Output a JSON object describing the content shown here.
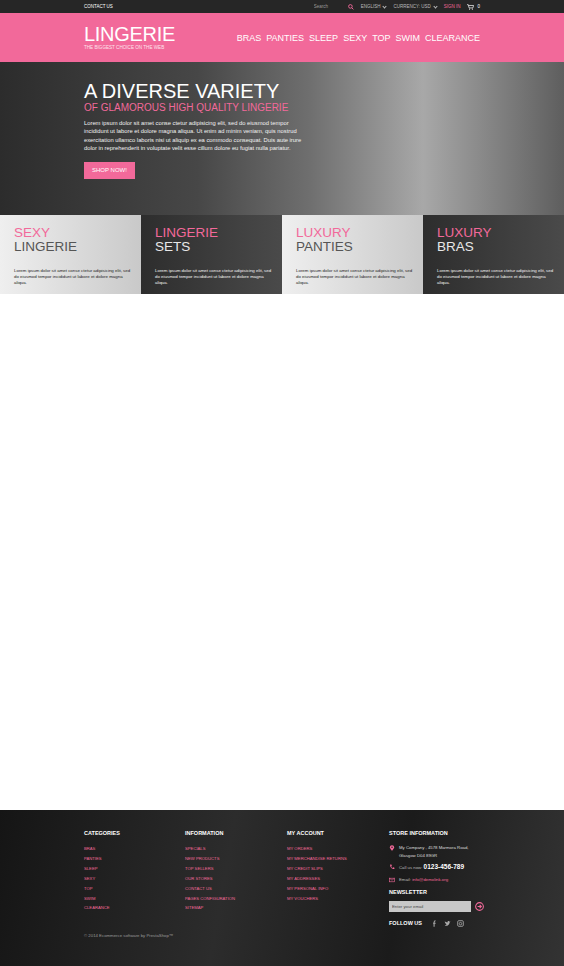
{
  "topbar": {
    "contact": "CONTACT US",
    "search_placeholder": "Search",
    "language": "ENGLISH",
    "currency": "CURRENCY: USD",
    "sign_in": "SIGN IN",
    "cart_count": "0"
  },
  "header": {
    "logo": "LINGERIE",
    "tagline": "THE BIGGEST CHOICE ON THE WEB",
    "nav": [
      "BRAS",
      "PANTIES",
      "SLEEP",
      "SEXY",
      "TOP",
      "SWIM",
      "CLEARANCE"
    ]
  },
  "hero": {
    "title": "A DIVERSE VARIETY",
    "subtitle": "OF GLAMOROUS HIGH QUALITY LINGERIE",
    "text": "Lorem ipsum dolor sit amet conse ctetur adipisicing elit, sed do eiusmod tempor incididunt ut labore et dolore magna aliqua. Ut enim ad minim veniam, quis nostrud exercitation ullamco laboris nisi ut aliquip ex ea commodo consequat. Duis aute irure dolor in reprehenderit in voluptate velit esse cillum dolore eu fugiat nulla pariatur.",
    "button": "SHOP NOW!"
  },
  "banners": [
    {
      "accent": "SEXY",
      "title": "LINGERIE",
      "text": "Lorem ipsum dolor sit amet conse ctetur adipisicing elit, sed do eiusmod tempor incididunt ut labore et dolore magna aliqua."
    },
    {
      "accent": "LINGERIE",
      "title": "SETS",
      "text": "Lorem ipsum dolor sit amet conse ctetur adipisicing elit, sed do eiusmod tempor incididunt ut labore et dolore magna aliqua."
    },
    {
      "accent": "LUXURY",
      "title": "PANTIES",
      "text": "Lorem ipsum dolor sit amet conse ctetur adipisicing elit, sed do eiusmod tempor incididunt ut labore et dolore magna aliqua."
    },
    {
      "accent": "LUXURY",
      "title": "BRAS",
      "text": "Lorem ipsum dolor sit amet conse ctetur adipisicing elit, sed do eiusmod tempor incididunt ut labore et dolore magna aliqua."
    }
  ],
  "footer": {
    "columns": [
      {
        "title": "CATEGORIES",
        "links": [
          "BRAS",
          "PANTIES",
          "SLEEP",
          "SEXY",
          "TOP",
          "SWIM",
          "CLEARANCE"
        ]
      },
      {
        "title": "INFORMATION",
        "links": [
          "SPECIALS",
          "NEW PRODUCTS",
          "TOP SELLERS",
          "OUR STORES",
          "CONTACT US",
          "PAGES CONFIGURATION",
          "SITEMAP"
        ]
      },
      {
        "title": "MY ACCOUNT",
        "links": [
          "MY ORDERS",
          "MY MERCHANDISE RETURNS",
          "MY CREDIT SLIPS",
          "MY ADDRESSES",
          "MY PERSONAL INFO",
          "MY VOUCHERS"
        ]
      }
    ],
    "store": {
      "title": "STORE INFORMATION",
      "address": "My Company , 4578 Marmora Road, Glasgow D04 89GR",
      "phone_label": "Call us now:",
      "phone": "0123-456-789",
      "email_label": "Email:",
      "email": "info@demolink.org"
    },
    "newsletter": {
      "title": "NEWSLETTER",
      "placeholder": "Enter your email"
    },
    "follow": "FOLLOW US",
    "copyright": "© 2014 Ecommerce software by PrestaShop™"
  }
}
